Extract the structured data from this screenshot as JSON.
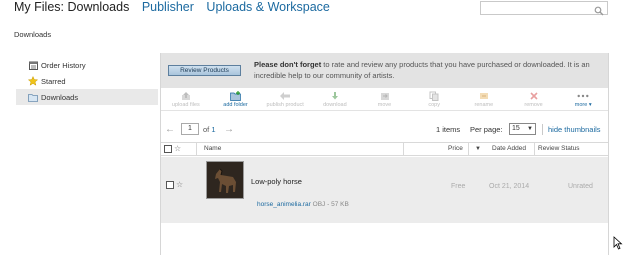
{
  "header": {
    "title": "My Files: Downloads",
    "links": [
      "Publisher",
      "Uploads & Workspace"
    ]
  },
  "breadcrumb": "Downloads",
  "sidebar": {
    "items": [
      {
        "label": "Order History",
        "icon": "calendar-icon"
      },
      {
        "label": "Starred",
        "icon": "star-icon"
      },
      {
        "label": "Downloads",
        "icon": "folder-icon",
        "active": true
      }
    ]
  },
  "banner": {
    "button_label": "Review Products",
    "text_bold": "Please don't forget",
    "text_rest": " to rate and review any products that you have purchased or downloaded. It is an incredible help to our community of artists."
  },
  "toolbar": {
    "upload_files": "upload files",
    "add_folder": "add folder",
    "publish_product": "publish product",
    "download": "download",
    "move": "move",
    "copy": "copy",
    "rename": "rename",
    "remove": "remove",
    "more": "more ▾"
  },
  "pager": {
    "page_value": "1",
    "of_prefix": "of",
    "total_pages": "1",
    "items_count": "1",
    "items_label": "items",
    "per_page_label": "Per page:",
    "per_page_value": "15",
    "hide_thumbnails": "hide thumbnails"
  },
  "table": {
    "headers": {
      "name": "Name",
      "price": "Price",
      "date_added": "Date Added",
      "review_status": "Review Status"
    },
    "rows": [
      {
        "name": "Low-poly horse",
        "file_name": "horse_animelia.rar",
        "file_type": "OBJ",
        "file_size": "- 57 KB",
        "price": "Free",
        "date_added": "Oct 21, 2014",
        "review_status": "Unrated"
      }
    ]
  },
  "colors": {
    "link": "#1c6aa0",
    "banner_bg": "#e3e3e3",
    "row_bg": "#ececec",
    "active_sidebar_bg": "#e9e9e9"
  }
}
